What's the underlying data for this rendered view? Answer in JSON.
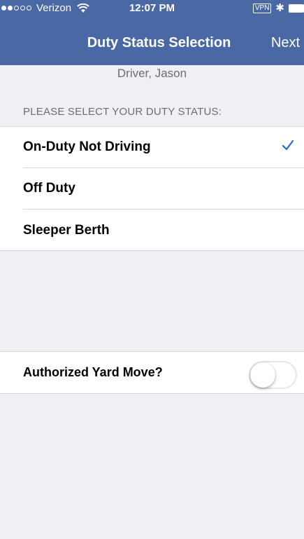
{
  "status_bar": {
    "carrier": "Verizon",
    "time": "12:07 PM",
    "vpn": "VPN",
    "bluetooth_icon": "bluetooth-icon",
    "signal_bars_filled": 2,
    "signal_bars_total": 5
  },
  "nav": {
    "title": "Duty Status Selection",
    "next_label": "Next",
    "bar_color": "#4a68a3"
  },
  "driver": {
    "name": "Driver, Jason"
  },
  "section": {
    "header": "PLEASE SELECT YOUR DUTY STATUS:"
  },
  "duty_options": [
    {
      "label": "On-Duty Not Driving",
      "selected": true
    },
    {
      "label": "Off Duty",
      "selected": false
    },
    {
      "label": "Sleeper Berth",
      "selected": false
    }
  ],
  "yard_move": {
    "label": "Authorized Yard Move?",
    "enabled": false
  },
  "colors": {
    "accent": "#2f63c6",
    "background": "#efeff4"
  }
}
